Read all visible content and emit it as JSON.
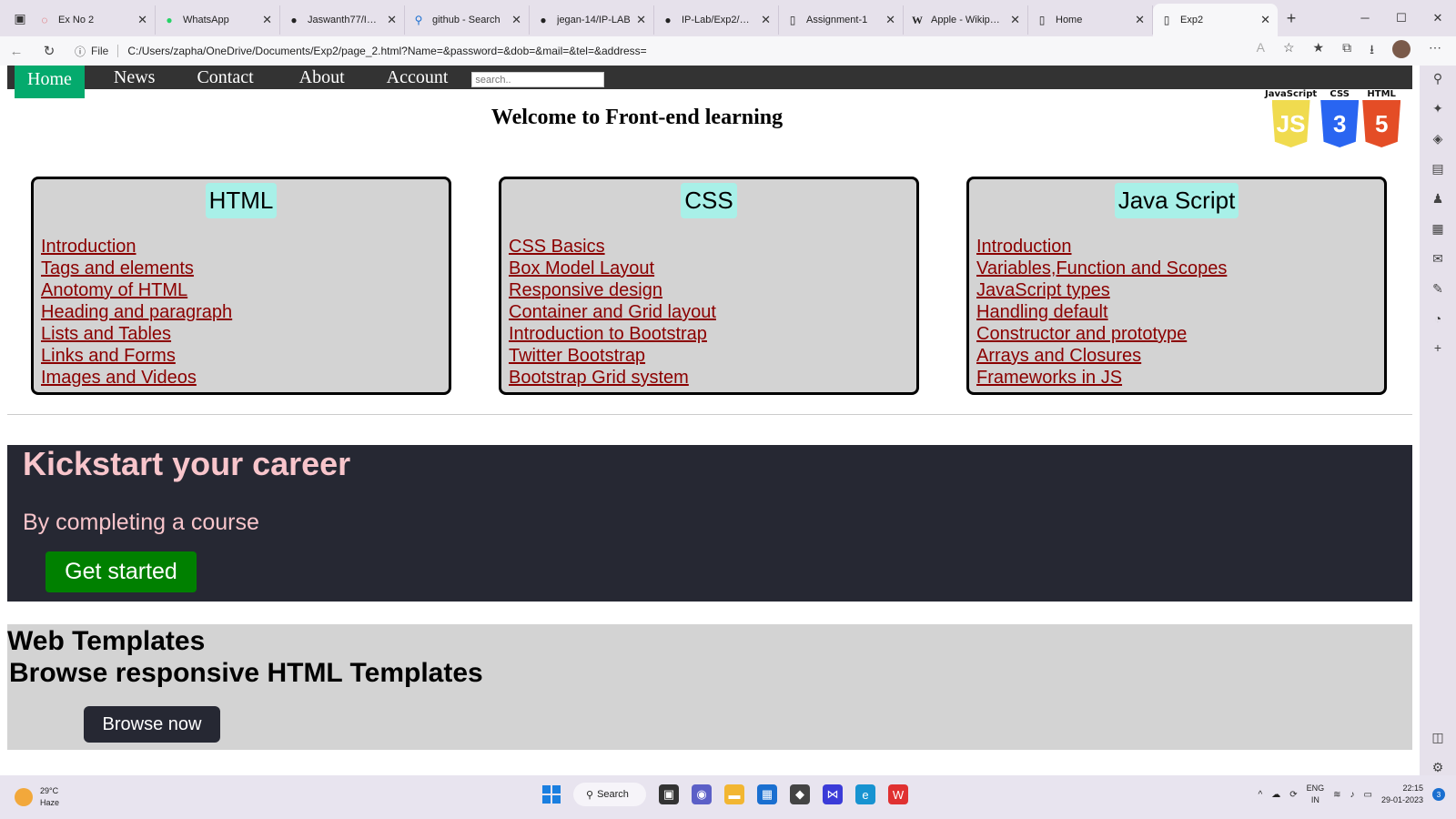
{
  "browser": {
    "tabs": [
      {
        "label": "Ex No 2",
        "icon": "recycle-icon",
        "active": false
      },
      {
        "label": "WhatsApp",
        "icon": "whatsapp-icon",
        "active": false
      },
      {
        "label": "Jaswanth77/IP-LAB",
        "icon": "github-icon",
        "active": false
      },
      {
        "label": "github - Search",
        "icon": "search-icon",
        "active": false
      },
      {
        "label": "jegan-14/IP-LAB",
        "icon": "github-icon",
        "active": false
      },
      {
        "label": "IP-Lab/Exp2/Output",
        "icon": "github-icon",
        "active": false
      },
      {
        "label": "Assignment-1",
        "icon": "document-icon",
        "active": false
      },
      {
        "label": "Apple - Wikipedia",
        "icon": "wikipedia-icon",
        "active": false
      },
      {
        "label": "Home",
        "icon": "document-icon",
        "active": false
      },
      {
        "label": "Exp2",
        "icon": "document-icon",
        "active": true
      }
    ],
    "address": {
      "scheme_label": "File",
      "url": "C:/Users/zapha/OneDrive/Documents/Exp2/page_2.html?Name=&password=&dob=&mail=&tel=&address="
    }
  },
  "page": {
    "nav": {
      "items": [
        "Home",
        "News",
        "Contact",
        "About",
        "Account"
      ],
      "search_placeholder": "search.."
    },
    "welcome": "Welcome to Front-end learning",
    "logos": {
      "js_caption": "JavaScript",
      "js_mark": "JS",
      "css_caption": "CSS",
      "css_mark": "3",
      "html_caption": "HTML",
      "html_mark": "5"
    },
    "cards": [
      {
        "title": "HTML",
        "links": [
          "Introduction",
          "Tags and elements",
          "Anotomy of HTML",
          "Heading and paragraph",
          "Lists and Tables",
          "Links and Forms",
          "Images and Videos"
        ]
      },
      {
        "title": "CSS",
        "links": [
          "CSS Basics",
          "Box Model Layout",
          "Responsive design",
          "Container and Grid layout",
          "Introduction to Bootstrap",
          "Twitter Bootstrap",
          "Bootstrap Grid system"
        ]
      },
      {
        "title": "Java Script",
        "links": [
          "Introduction",
          "Variables,Function and Scopes",
          "JavaScript types",
          "Handling default",
          "Constructor and prototype",
          "Arrays and Closures",
          "Frameworks in JS"
        ]
      }
    ],
    "hero": {
      "heading": "Kickstart your career",
      "subtext": "By completing a course",
      "button": "Get started"
    },
    "templates": {
      "heading": "Web Templates",
      "subheading": "Browse responsive HTML Templates",
      "button": "Browse now"
    }
  },
  "taskbar": {
    "weather_temp": "29°C",
    "weather_desc": "Haze",
    "search_label": "Search",
    "lang_top": "ENG",
    "lang_bottom": "IN",
    "time": "22:15",
    "date": "29-01-2023",
    "notif_count": "3"
  },
  "colors": {
    "nav_bg": "#333333",
    "nav_active": "#04aa6d",
    "card_bg": "#d3d3d3",
    "card_title_bg": "#a8f0e8",
    "link": "#8b0000",
    "hero_bg": "#262833",
    "hero_text": "#f8c5cb",
    "get_started": "#008000"
  }
}
